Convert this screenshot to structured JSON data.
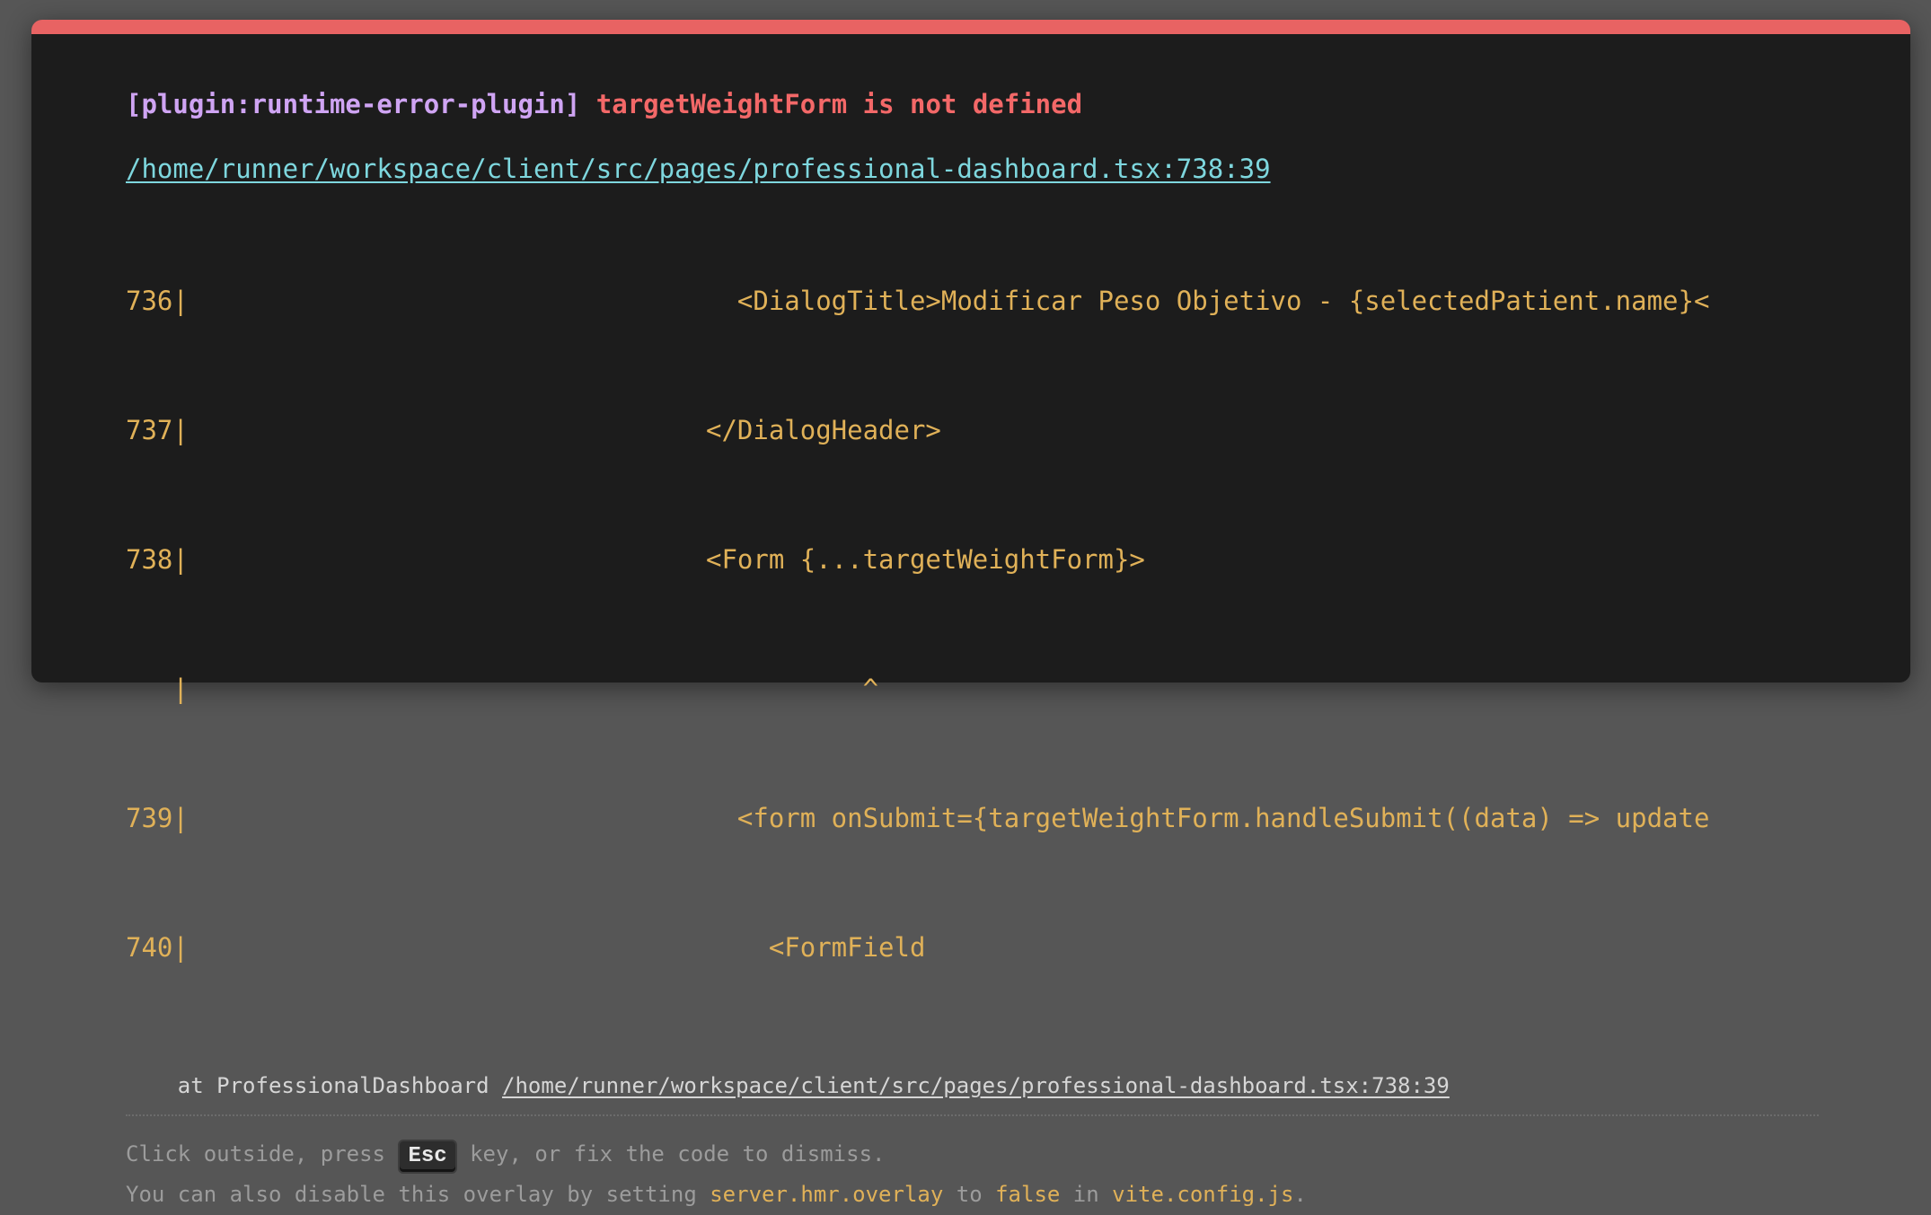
{
  "error": {
    "plugin": "[plugin:runtime-error-plugin]",
    "message": "targetWeightForm is not defined",
    "file": "/home/runner/workspace/client/src/pages/professional-dashboard.tsx:738:39"
  },
  "code_frame": [
    "736|                                   <DialogTitle>Modificar Peso Objetivo - {selectedPatient.name}<",
    "737|                                 </DialogHeader>",
    "738|                                 <Form {...targetWeightForm}>",
    "   |                                           ^",
    "739|                                   <form onSubmit={targetWeightForm.handleSubmit((data) => update",
    "740|                                     <FormField"
  ],
  "stack": {
    "prefix": "    at ProfessionalDashboard ",
    "link": "/home/runner/workspace/client/src/pages/professional-dashboard.tsx:738:39"
  },
  "tip": {
    "line1_before": "Click outside, press ",
    "key": "Esc",
    "line1_after": " key, or fix the code to dismiss.",
    "line2_a": "You can also disable this overlay by setting ",
    "line2_code1": "server.hmr.overlay",
    "line2_b": " to ",
    "line2_code2": "false",
    "line2_c": " in ",
    "line2_code3": "vite.config.js",
    "line2_d": "."
  },
  "colors": {
    "accent_bar": "#e86363",
    "plugin": "#cfa4f3",
    "error": "#f36868",
    "link": "#7ed7de",
    "code": "#e0b158"
  }
}
